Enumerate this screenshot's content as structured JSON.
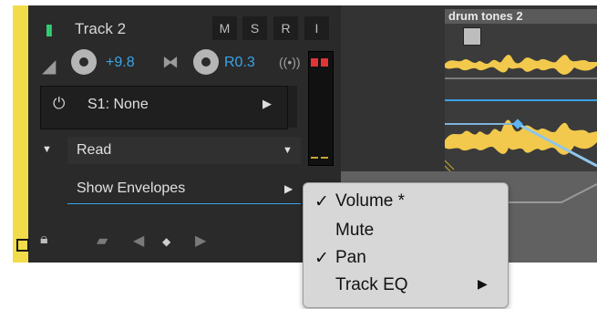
{
  "track": {
    "name": "Track 2",
    "buttons": [
      "M",
      "S",
      "R",
      "I"
    ],
    "volume_value": "+9.8",
    "pan_value": "R0.3",
    "fx_slot": "S1: None",
    "automation_mode": "Read",
    "show_envelopes": "Show Envelopes"
  },
  "clip": {
    "name": "drum tones 2"
  },
  "context_menu": {
    "items": [
      {
        "label": "Volume *",
        "checked": true
      },
      {
        "label": "Mute",
        "checked": false
      },
      {
        "label": "Pan",
        "checked": true
      },
      {
        "label": "Track EQ",
        "checked": false,
        "submenu": true
      }
    ]
  },
  "colors": {
    "panel": "#2a2a2a",
    "yellow": "#f2dc4a",
    "accent": "#3aa3e6",
    "waveform": "#f2c94c",
    "menu": "#d7d7d7"
  }
}
